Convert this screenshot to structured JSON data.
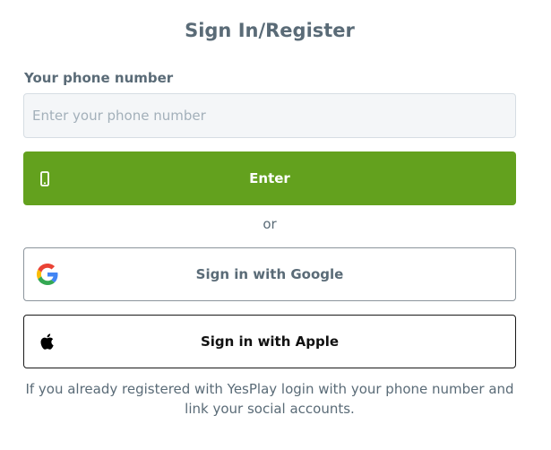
{
  "header": {
    "title": "Sign In/Register"
  },
  "phone": {
    "label": "Your phone number",
    "placeholder": "Enter your phone number",
    "value": ""
  },
  "enter_button": {
    "label": "Enter",
    "icon": "smartphone-icon"
  },
  "divider": {
    "text": "or"
  },
  "google_button": {
    "label": "Sign in with Google",
    "icon": "google-logo-icon"
  },
  "apple_button": {
    "label": "Sign in with Apple",
    "icon": "apple-logo-icon"
  },
  "footer_note": {
    "text": "If you already registered with YesPlay login with your phone number and link your social accounts."
  },
  "colors": {
    "primary_green": "#63a11e",
    "text": "#5a6b77",
    "input_bg": "#f4f6f8",
    "placeholder": "#a3b0ba"
  }
}
